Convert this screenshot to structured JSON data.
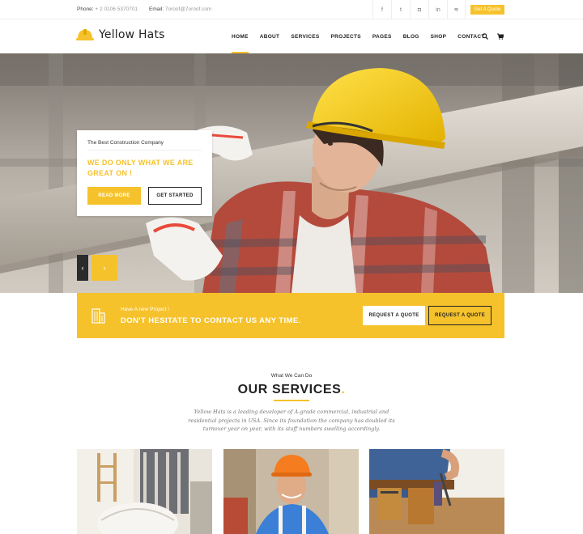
{
  "topbar": {
    "phone_label": "Phone:",
    "phone_value": "+ 2 0106 5370701",
    "email_label": "Email:",
    "email_value": "7oroof@7oroof.com",
    "socials": [
      {
        "icon": "facebook-icon",
        "glyph": "f"
      },
      {
        "icon": "twitter-icon",
        "glyph": "t"
      },
      {
        "icon": "instagram-icon",
        "glyph": "◘"
      },
      {
        "icon": "linkedin-icon",
        "glyph": "in"
      },
      {
        "icon": "rss-icon",
        "glyph": "≋"
      }
    ],
    "quote_button": "Get A Quote"
  },
  "header": {
    "brand": "Yellow Hats",
    "nav": [
      "HOME",
      "ABOUT",
      "SERVICES",
      "PROJECTS",
      "PAGES",
      "BLOG",
      "SHOP",
      "CONTACT"
    ],
    "active_nav": "HOME",
    "icons": [
      "search-icon",
      "cart-icon"
    ]
  },
  "hero": {
    "subtitle": "The Best Construction Company",
    "headline": "WE DO ONLY WHAT WE ARE GREAT ON !",
    "read_more": "READ MORE",
    "get_started": "GET STARTED",
    "prev_glyph": "‹",
    "next_glyph": "›"
  },
  "cta": {
    "small": "Have A new Project !",
    "big": "DON'T HESITATE TO CONTACT US ANY TIME.",
    "button_1": "REQUEST A QUOTE",
    "button_2": "REQUEST A QUOTE"
  },
  "services": {
    "kicker": "What We Can Do",
    "title": "OUR SERVICES",
    "title_dot": ".",
    "description": "Yellow Hats is a leading developer of A-grade commercial, industrial and residential projects in USA. Since its foundation the company has doubled its turnover year on year, with its staff numbers swelling accordingly."
  },
  "colors": {
    "accent": "#f6c22c",
    "dark": "#222222"
  }
}
